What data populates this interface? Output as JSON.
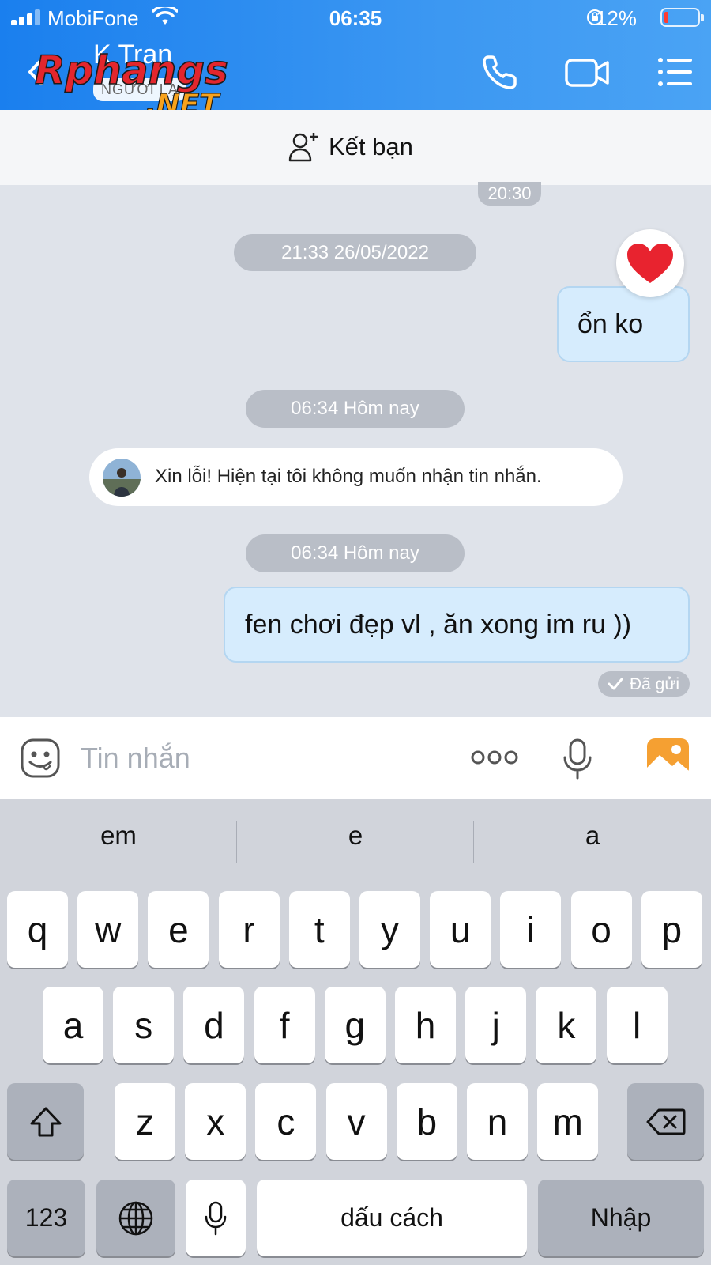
{
  "status_bar": {
    "carrier": "MobiFone",
    "time": "06:35",
    "battery_text": "12%",
    "battery_color": "#ff3b30"
  },
  "header": {
    "contact_name": "K Tran",
    "stranger_tag": "NGƯỜI LẠ",
    "watermark": "Rphangs .NET",
    "icons": [
      "back-icon",
      "phone-icon",
      "video-icon",
      "menu-icon"
    ]
  },
  "add_friend": {
    "label": "Kết bạn",
    "icon": "add-user-icon"
  },
  "chat": {
    "partial_time": "20:30",
    "time_1": "21:33 26/05/2022",
    "msg_1": "ổn ko",
    "msg_1_reaction": "❤️",
    "time_2": "06:34 Hôm nay",
    "system_msg": "Xin lỗi! Hiện tại tôi không muốn nhận tin nhắn.",
    "time_3": "06:34 Hôm nay",
    "msg_2": "fen chơi đẹp vl , ăn xong im ru ))",
    "sent_status": "Đã gửi"
  },
  "input_bar": {
    "placeholder": "Tin nhắn",
    "icons": [
      "emoji-icon",
      "more-icon",
      "microphone-icon",
      "image-icon"
    ]
  },
  "colors": {
    "header_blue": "#1a7fee",
    "bubble_out": "#d6ecfd",
    "chat_bg": "#dfe3ea",
    "image_orange": "#f5a032"
  },
  "keyboard": {
    "suggestions": [
      "em",
      "e",
      "a"
    ],
    "row1": [
      "q",
      "w",
      "e",
      "r",
      "t",
      "y",
      "u",
      "i",
      "o",
      "p"
    ],
    "row2": [
      "a",
      "s",
      "d",
      "f",
      "g",
      "h",
      "j",
      "k",
      "l"
    ],
    "row3": [
      "z",
      "x",
      "c",
      "v",
      "b",
      "n",
      "m"
    ],
    "numbers_key": "123",
    "space_key": "dấu cách",
    "return_key": "Nhập",
    "icons": [
      "shift-icon",
      "backspace-icon",
      "globe-icon",
      "dictation-icon"
    ]
  }
}
